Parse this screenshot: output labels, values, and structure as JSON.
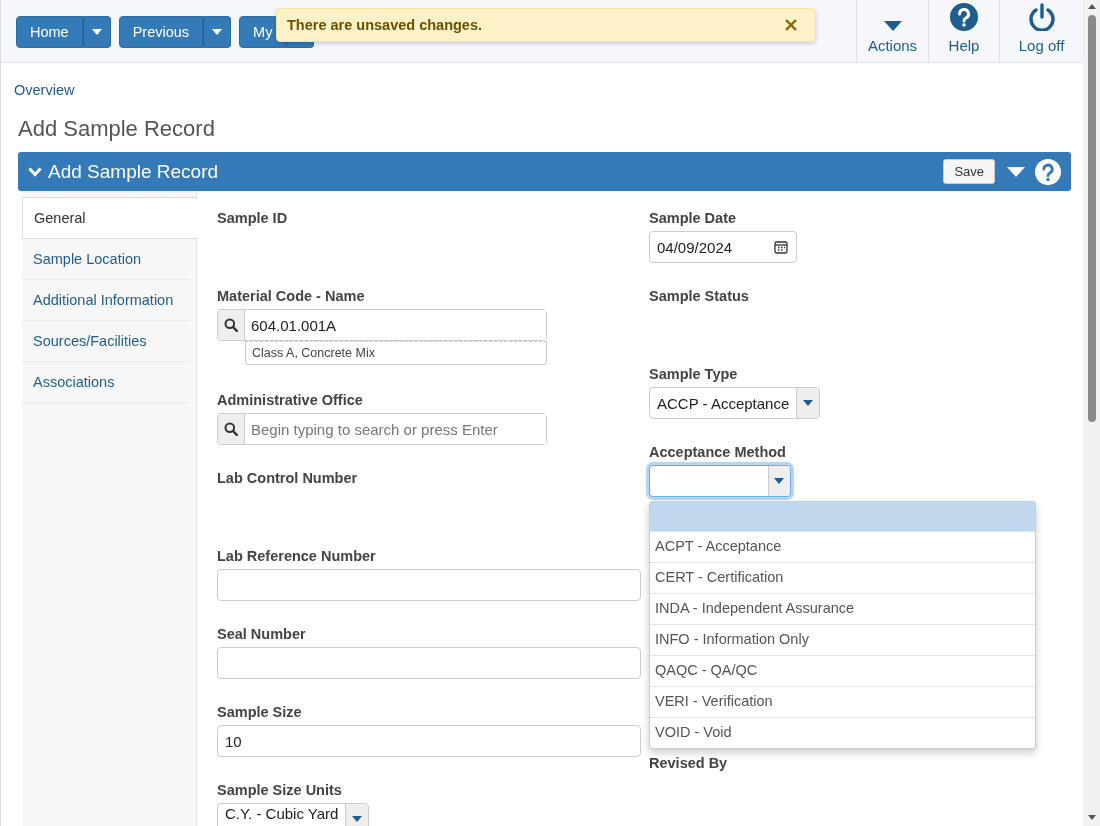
{
  "nav": {
    "buttons": [
      {
        "label": "Home"
      },
      {
        "label": "Previous"
      },
      {
        "label": "My"
      }
    ],
    "actions": [
      {
        "kind": "actions",
        "label": "Actions"
      },
      {
        "kind": "help",
        "label": "Help"
      },
      {
        "kind": "logoff",
        "label": "Log off"
      }
    ]
  },
  "toast": {
    "message": "There are unsaved changes."
  },
  "breadcrumb": "Overview",
  "page_title": "Add Sample Record",
  "panel": {
    "title": "Add Sample Record",
    "save": "Save"
  },
  "tabs": [
    {
      "label": "General",
      "selected": true
    },
    {
      "label": "Sample Location",
      "selected": false
    },
    {
      "label": "Additional Information",
      "selected": false
    },
    {
      "label": "Sources/Facilities",
      "selected": false
    },
    {
      "label": "Associations",
      "selected": false
    }
  ],
  "form": {
    "left": [
      {
        "kind": "empty",
        "label": "Sample ID"
      },
      {
        "kind": "lookup",
        "label": "Material Code - Name",
        "value": "604.01.001A",
        "description": "Class A, Concrete Mix"
      },
      {
        "kind": "lookup",
        "label": "Administrative Office",
        "placeholder": "Begin typing to search or press Enter"
      },
      {
        "kind": "empty",
        "label": "Lab Control Number"
      },
      {
        "kind": "text",
        "label": "Lab Reference Number"
      },
      {
        "kind": "text",
        "label": "Seal Number"
      },
      {
        "kind": "text",
        "label": "Sample Size",
        "value": "10"
      },
      {
        "kind": "select",
        "label": "Sample Size Units",
        "value": "C.Y. - Cubic Yard",
        "expanded": false
      }
    ],
    "right": [
      {
        "kind": "date",
        "label": "Sample Date",
        "value": "04/09/2024"
      },
      {
        "kind": "empty",
        "label": "Sample Status"
      },
      {
        "kind": "select",
        "label": "Sample Type",
        "value": "ACCP - Acceptance",
        "expanded": false
      },
      {
        "kind": "select",
        "label": "Acceptance Method",
        "expanded": true,
        "options": [
          "ACPT - Acceptance",
          "CERT - Certification",
          "INDA - Independent Assurance",
          "INFO - Information Only",
          "QAQC - QA/QC",
          "VERI - Verification",
          "VOID - Void"
        ]
      },
      {
        "kind": "empty",
        "label": "Revised By"
      }
    ]
  }
}
